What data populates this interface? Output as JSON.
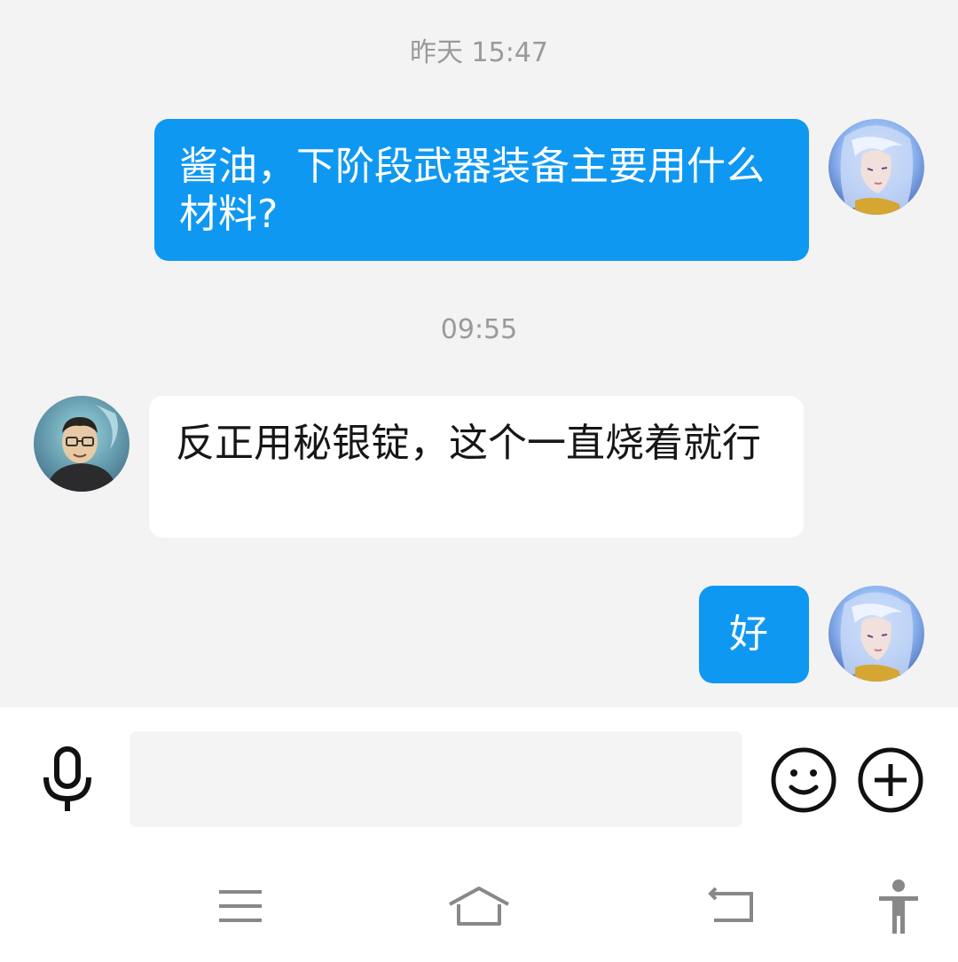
{
  "messages": [
    {
      "type": "timestamp",
      "text": "昨天 15:47"
    },
    {
      "type": "outgoing",
      "text": "酱油，下阶段武器装备主要用什么材料?",
      "avatar": "user-avatar-anime"
    },
    {
      "type": "timestamp",
      "text": "09:55"
    },
    {
      "type": "incoming",
      "text": "反正用秘银锭，这个一直烧着就行",
      "avatar": "contact-avatar-glasses-man"
    },
    {
      "type": "outgoing",
      "text": "好",
      "avatar": "user-avatar-anime"
    }
  ],
  "input_bar": {
    "text_value": "",
    "placeholder": "",
    "voice_icon": "microphone-icon",
    "emoji_icon": "smiley-icon",
    "more_icon": "plus-circle-icon"
  },
  "nav_bar": {
    "icons": [
      "menu-icon",
      "home-icon",
      "back-icon",
      "accessibility-icon"
    ]
  },
  "colors": {
    "chat_background": "#f3f3f3",
    "outgoing_bubble": "#0f98f2",
    "incoming_bubble": "#ffffff",
    "timestamp_text": "#9a9a9a"
  }
}
